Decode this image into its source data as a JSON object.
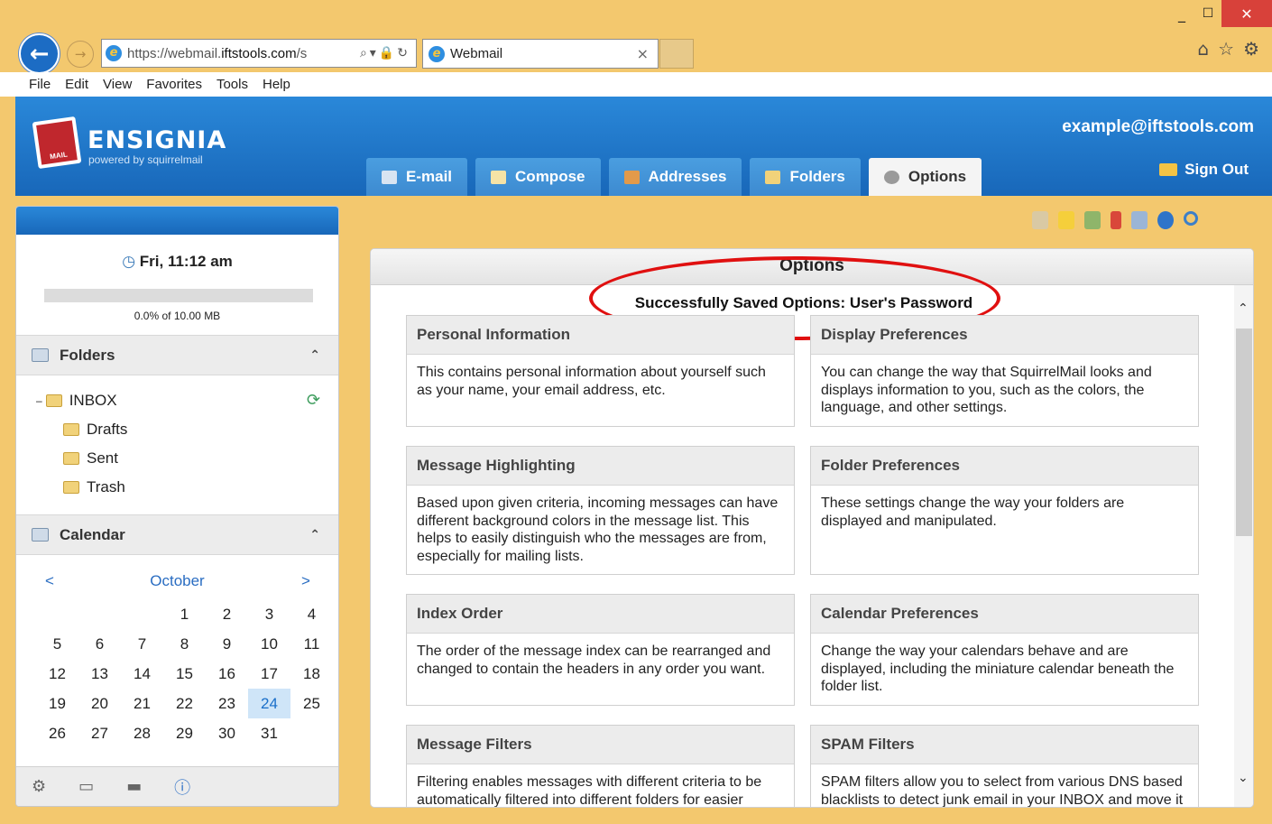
{
  "browser": {
    "url_prefix": "https://webmail.",
    "url_host": "iftstools.com",
    "url_rest": "/s",
    "tab_title": "Webmail",
    "menu": [
      "File",
      "Edit",
      "View",
      "Favorites",
      "Tools",
      "Help"
    ]
  },
  "header": {
    "brand": "ENSIGNIA",
    "brand_sub": "powered by squirrelmail",
    "logo_text": "MAIL",
    "user_email": "example@iftstools.com",
    "sign_out": "Sign Out",
    "tabs": [
      {
        "label": "E-mail",
        "icon": "envelope-icon",
        "color": "#d8e4f2"
      },
      {
        "label": "Compose",
        "icon": "pencil-icon",
        "color": "#f6e3a6"
      },
      {
        "label": "Addresses",
        "icon": "address-book-icon",
        "color": "#e29a4a"
      },
      {
        "label": "Folders",
        "icon": "folder-icon",
        "color": "#f1d27a"
      },
      {
        "label": "Options",
        "icon": "gear-icon",
        "color": "#9a9a9a",
        "active": true
      }
    ]
  },
  "sidebar": {
    "clock": "Fri, 11:12 am",
    "quota_percent": 0.0,
    "quota_text": "0.0% of 10.00 MB",
    "folders_title": "Folders",
    "folders": [
      {
        "name": "INBOX"
      },
      {
        "name": "Drafts"
      },
      {
        "name": "Sent"
      },
      {
        "name": "Trash"
      }
    ],
    "calendar_title": "Calendar",
    "calendar": {
      "prev": "<",
      "next": ">",
      "month": "October",
      "lead_blanks": 3,
      "days": 31,
      "today": 24
    }
  },
  "main": {
    "panel_title": "Options",
    "saved_message": "Successfully Saved Options: User's Password",
    "cards": [
      {
        "title": "Personal Information",
        "text": "This contains personal information about yourself such as your name, your email address, etc."
      },
      {
        "title": "Display Preferences",
        "text": "You can change the way that SquirrelMail looks and displays information to you, such as the colors, the language, and other settings."
      },
      {
        "title": "Message Highlighting",
        "text": "Based upon given criteria, incoming messages can have different background colors in the message list. This helps to easily distinguish who the messages are from, especially for mailing lists."
      },
      {
        "title": "Folder Preferences",
        "text": "These settings change the way your folders are displayed and manipulated."
      },
      {
        "title": "Index Order",
        "text": "The order of the message index can be rearranged and changed to contain the headers in any order you want."
      },
      {
        "title": "Calendar Preferences",
        "text": "Change the way your calendars behave and are displayed, including the miniature calendar beneath the folder list."
      },
      {
        "title": "Message Filters",
        "text": "Filtering enables messages with different criteria to be automatically filtered into different folders for easier organization."
      },
      {
        "title": "SPAM Filters",
        "text": "SPAM filters allow you to select from various DNS based blacklists to detect junk email in your INBOX and move it to another folder (like Trash)."
      }
    ]
  }
}
